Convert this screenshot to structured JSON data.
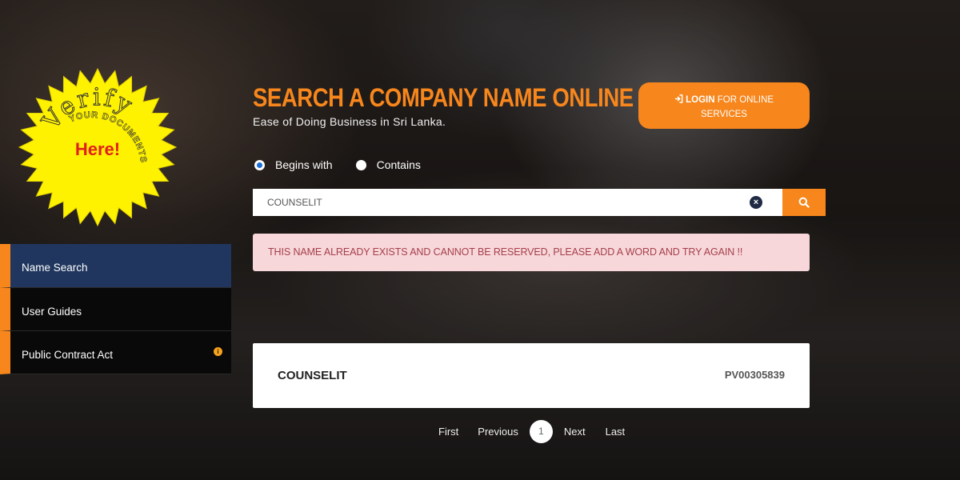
{
  "badge": {
    "verify": "Verify",
    "here": "Here!",
    "documents": "YOUR DOCUMENTS"
  },
  "header": {
    "title": "SEARCH A COMPANY NAME ONLINE",
    "subtitle": "Ease of Doing Business in Sri Lanka."
  },
  "login": {
    "bold": "LOGIN",
    "rest": " FOR ONLINE SERVICES",
    "icon": "sign-in-icon"
  },
  "search_mode": {
    "options": [
      "Begins with",
      "Contains"
    ],
    "selected": "Begins with"
  },
  "search": {
    "value": "COUNSELIT",
    "placeholder": ""
  },
  "alert": {
    "message": "THIS NAME ALREADY EXISTS AND CANNOT BE RESERVED, PLEASE ADD A WORD AND TRY AGAIN !!"
  },
  "menu": {
    "items": [
      "Name Search",
      "User Guides",
      "Public Contract Act"
    ],
    "active": "Name Search"
  },
  "result": {
    "name": "COUNSELIT",
    "number": "PV00305839"
  },
  "pagination": {
    "first": "First",
    "previous": "Previous",
    "current": "1",
    "next": "Next",
    "last": "Last"
  },
  "colors": {
    "accent": "#f7861c",
    "menu_active": "#20365e",
    "alert_bg": "#f8d7da",
    "alert_text": "#a4404b"
  }
}
